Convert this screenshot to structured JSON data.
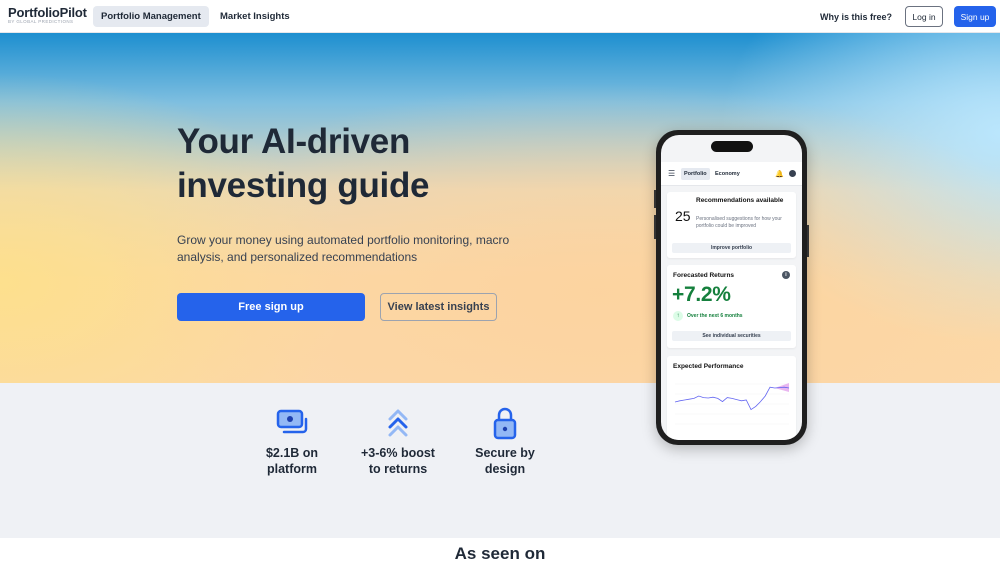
{
  "nav": {
    "logo": "PortfolioPilot",
    "logo_sub": "BY GLOBAL PREDICTIONS",
    "tabs": [
      {
        "label": "Portfolio Management",
        "active": true
      },
      {
        "label": "Market Insights",
        "active": false
      }
    ],
    "why_free": "Why is this free?",
    "login": "Log in",
    "signup": "Sign up"
  },
  "hero": {
    "title_line1": "Your AI-driven",
    "title_line2": "investing guide",
    "subtitle": "Grow your money using automated portfolio monitoring, macro analysis, and personalized recommendations",
    "primary_cta": "Free sign up",
    "secondary_cta": "View latest insights"
  },
  "phone": {
    "menu_icon": "hamburger-icon",
    "tabs": [
      "Portfolio",
      "Economy"
    ],
    "recommendations": {
      "count": "25",
      "title": "Recommendations available",
      "description": "Personalised suggestions for how your portfolio could be improved",
      "button": "Improve portfolio"
    },
    "forecast": {
      "title": "Forecasted Returns",
      "value": "+7.2%",
      "subtitle": "Over the next 6 months",
      "button": "See individual securities"
    },
    "performance": {
      "title": "Expected Performance",
      "series": [
        0.55,
        0.58,
        0.6,
        0.62,
        0.64,
        0.7,
        0.66,
        0.65,
        0.67,
        0.64,
        0.56,
        0.66,
        0.64,
        0.61,
        0.58,
        0.6,
        0.36,
        0.44,
        0.56,
        0.7,
        0.92,
        0.9,
        0.91,
        0.92,
        0.9
      ]
    }
  },
  "features": [
    {
      "icon": "money-icon",
      "line1": "$2.1B on",
      "line2": "platform"
    },
    {
      "icon": "chevrons-up-icon",
      "line1": "+3-6% boost",
      "line2": "to returns"
    },
    {
      "icon": "lock-icon",
      "line1": "Secure by",
      "line2": "design"
    }
  ],
  "as_seen_on": "As seen on",
  "colors": {
    "brand_blue": "#2563eb",
    "positive_green": "#15803d"
  }
}
